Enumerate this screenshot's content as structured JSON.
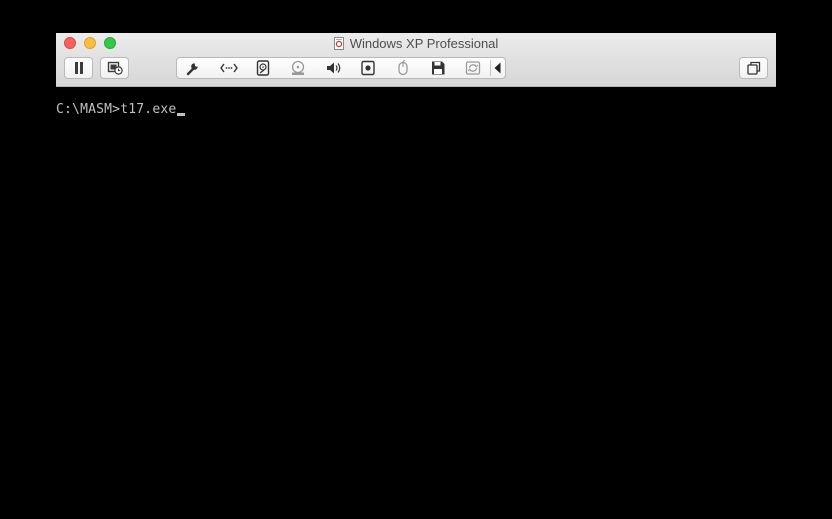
{
  "window": {
    "title": "Windows XP Professional",
    "title_icon": "vm-document-icon",
    "colors": {
      "titlebar_top": "#ececec",
      "titlebar_bottom": "#d6d6d6",
      "close": "#fc605c",
      "minimize": "#fdbc40",
      "maximize": "#34c84a"
    }
  },
  "toolbar": {
    "left_buttons": [
      {
        "name": "pause-button",
        "icon": "pause-icon"
      },
      {
        "name": "snapshot-button",
        "icon": "snapshot-clock-icon"
      }
    ],
    "device_items": [
      {
        "name": "settings-button",
        "icon": "wrench-icon"
      },
      {
        "name": "network-button",
        "icon": "network-arrows-icon"
      },
      {
        "name": "hard-disk-button",
        "icon": "hard-disk-icon"
      },
      {
        "name": "cd-dvd-button",
        "icon": "cd-eject-icon"
      },
      {
        "name": "sound-button",
        "icon": "speaker-icon"
      },
      {
        "name": "camera-button",
        "icon": "camera-icon"
      },
      {
        "name": "usb-mouse-button",
        "icon": "mouse-icon"
      },
      {
        "name": "floppy-button",
        "icon": "floppy-icon"
      },
      {
        "name": "shared-folders-button",
        "icon": "sync-icon"
      },
      {
        "name": "collapse-toolbar-button",
        "icon": "triangle-left-icon"
      }
    ],
    "right_buttons": [
      {
        "name": "window-mode-button",
        "icon": "window-stack-icon"
      }
    ]
  },
  "screen": {
    "prompt": "C:\\MASM>",
    "command": "t17.exe",
    "background": "#000000",
    "text_color": "#c0c0c0"
  }
}
